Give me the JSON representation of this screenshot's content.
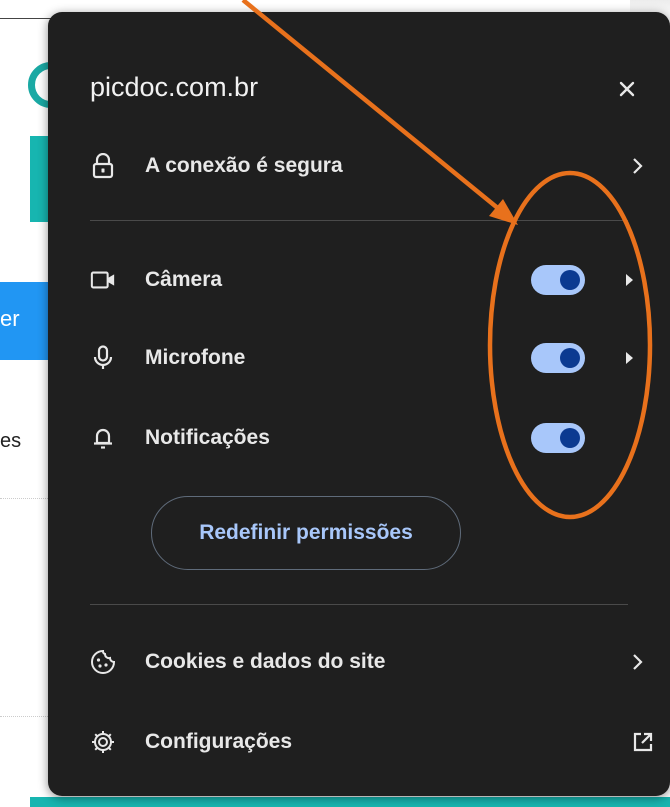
{
  "background": {
    "partial_button_text": "er",
    "partial_text": "es"
  },
  "popup": {
    "site": "picdoc.com.br",
    "close_icon": "close-icon",
    "connection": {
      "label": "A conexão é segura",
      "icon": "lock-icon"
    },
    "permissions": [
      {
        "label": "Câmera",
        "icon": "camera-icon",
        "enabled": true,
        "has_arrow": true
      },
      {
        "label": "Microfone",
        "icon": "microphone-icon",
        "enabled": true,
        "has_arrow": true
      },
      {
        "label": "Notificações",
        "icon": "bell-icon",
        "enabled": true,
        "has_arrow": false
      }
    ],
    "reset_button": "Redefinir permissões",
    "cookies": {
      "label": "Cookies e dados do site",
      "icon": "cookie-icon"
    },
    "settings": {
      "label": "Configurações",
      "icon": "gear-icon",
      "action_icon": "open-external-icon"
    }
  },
  "colors": {
    "popup_bg": "#1f1f1f",
    "toggle_track": "#a8c7fa",
    "toggle_knob": "#0b3a91",
    "link_text": "#a8c7fa",
    "annotation": "#e8711c",
    "teal": "#17b5b0",
    "blue": "#2196f3"
  }
}
